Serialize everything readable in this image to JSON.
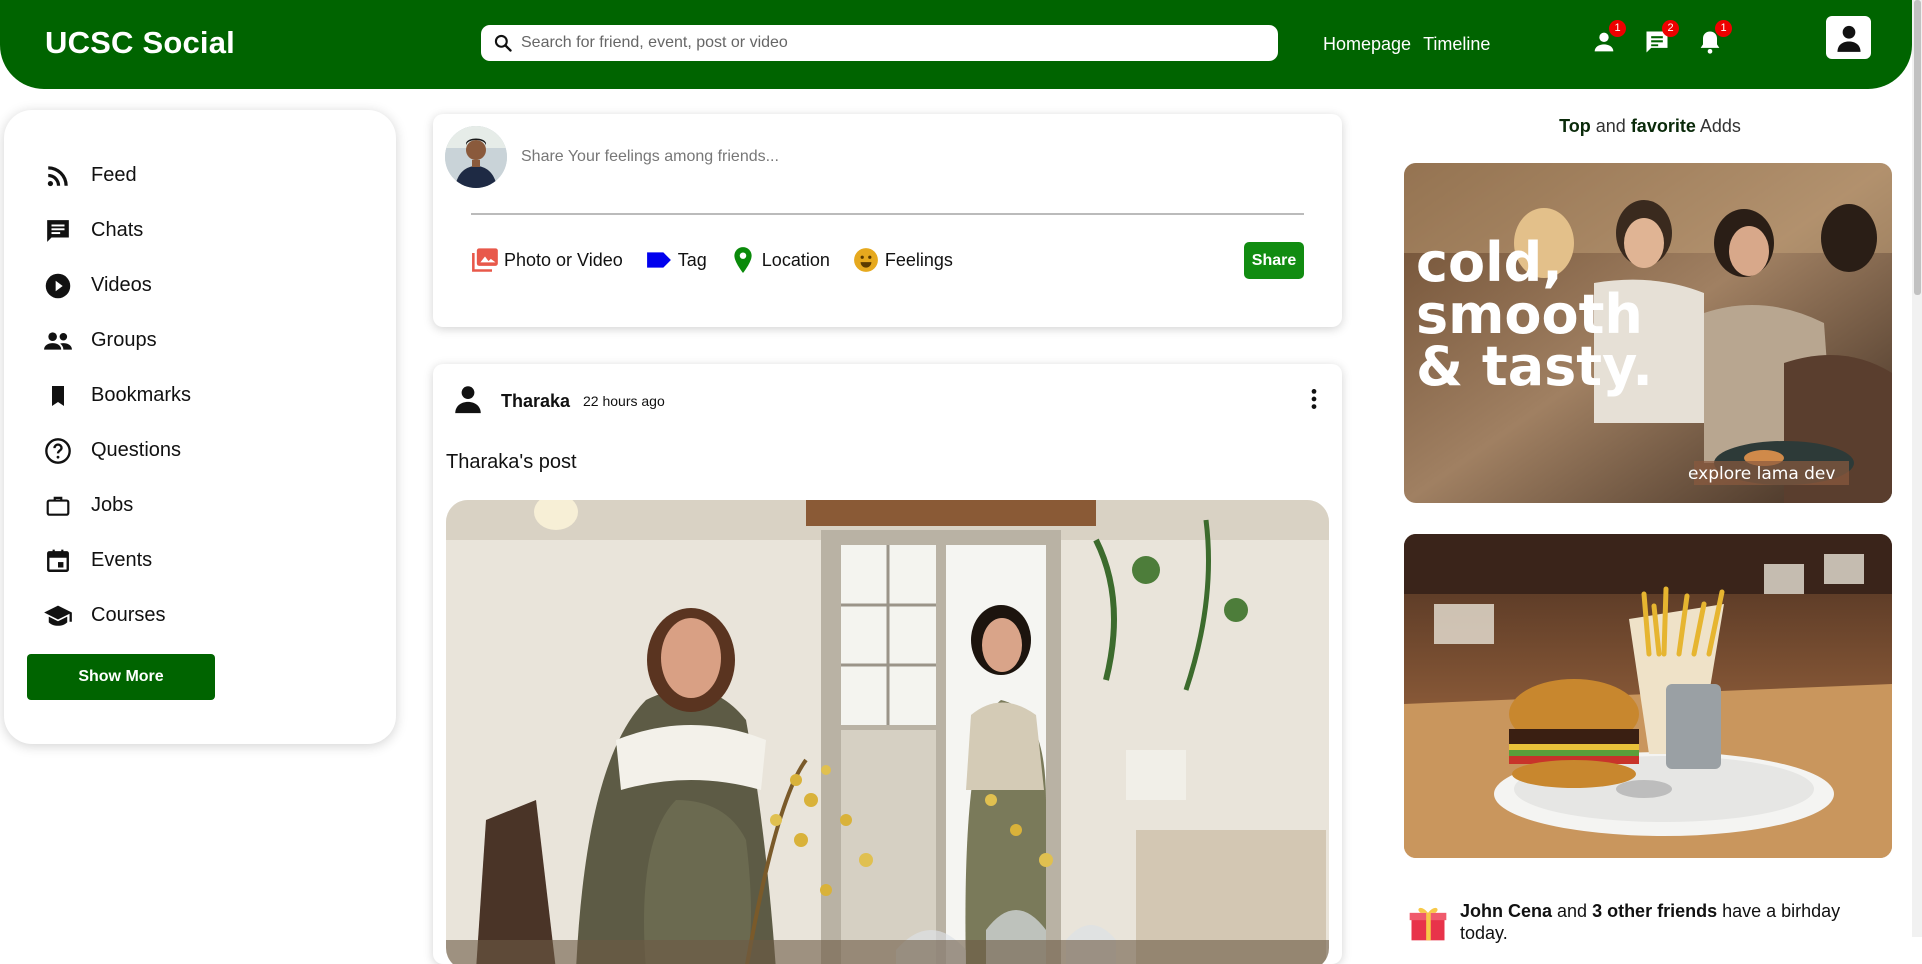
{
  "header": {
    "brand": "UCSC Social",
    "search_placeholder": "Search for friend, event, post or video",
    "links": [
      "Homepage",
      "Timeline"
    ],
    "badges": {
      "friends": "1",
      "messages": "2",
      "notifications": "1"
    }
  },
  "sidebar": {
    "items": [
      {
        "label": "Feed",
        "icon": "rss-feed-icon"
      },
      {
        "label": "Chats",
        "icon": "chat-icon"
      },
      {
        "label": "Videos",
        "icon": "play-circle-icon"
      },
      {
        "label": "Groups",
        "icon": "group-icon"
      },
      {
        "label": "Bookmarks",
        "icon": "bookmark-icon"
      },
      {
        "label": "Questions",
        "icon": "help-circle-icon"
      },
      {
        "label": "Jobs",
        "icon": "briefcase-icon"
      },
      {
        "label": "Events",
        "icon": "calendar-icon"
      },
      {
        "label": "Courses",
        "icon": "school-icon"
      }
    ],
    "show_more": "Show More"
  },
  "share": {
    "placeholder": "Share Your feelings among friends...",
    "options": [
      "Photo or Video",
      "Tag",
      "Location",
      "Feelings"
    ],
    "button": "Share"
  },
  "post": {
    "username": "Tharaka",
    "time": "22 hours ago",
    "text": "Tharaka's post"
  },
  "ads": {
    "title_top": "Top",
    "title_and": " and ",
    "title_fav": "favorite",
    "title_adds": " Adds",
    "ad1_lines": [
      "cold,",
      "smooth",
      "& tasty."
    ],
    "ad1_footer": "explore lama dev"
  },
  "birthday": {
    "name": "John Cena",
    "and": " and ",
    "friends": "3 other friends",
    "rest": " have a birhday today."
  },
  "colors": {
    "primary": "#006400",
    "share_button": "#118c11",
    "badge": "#e00000"
  }
}
